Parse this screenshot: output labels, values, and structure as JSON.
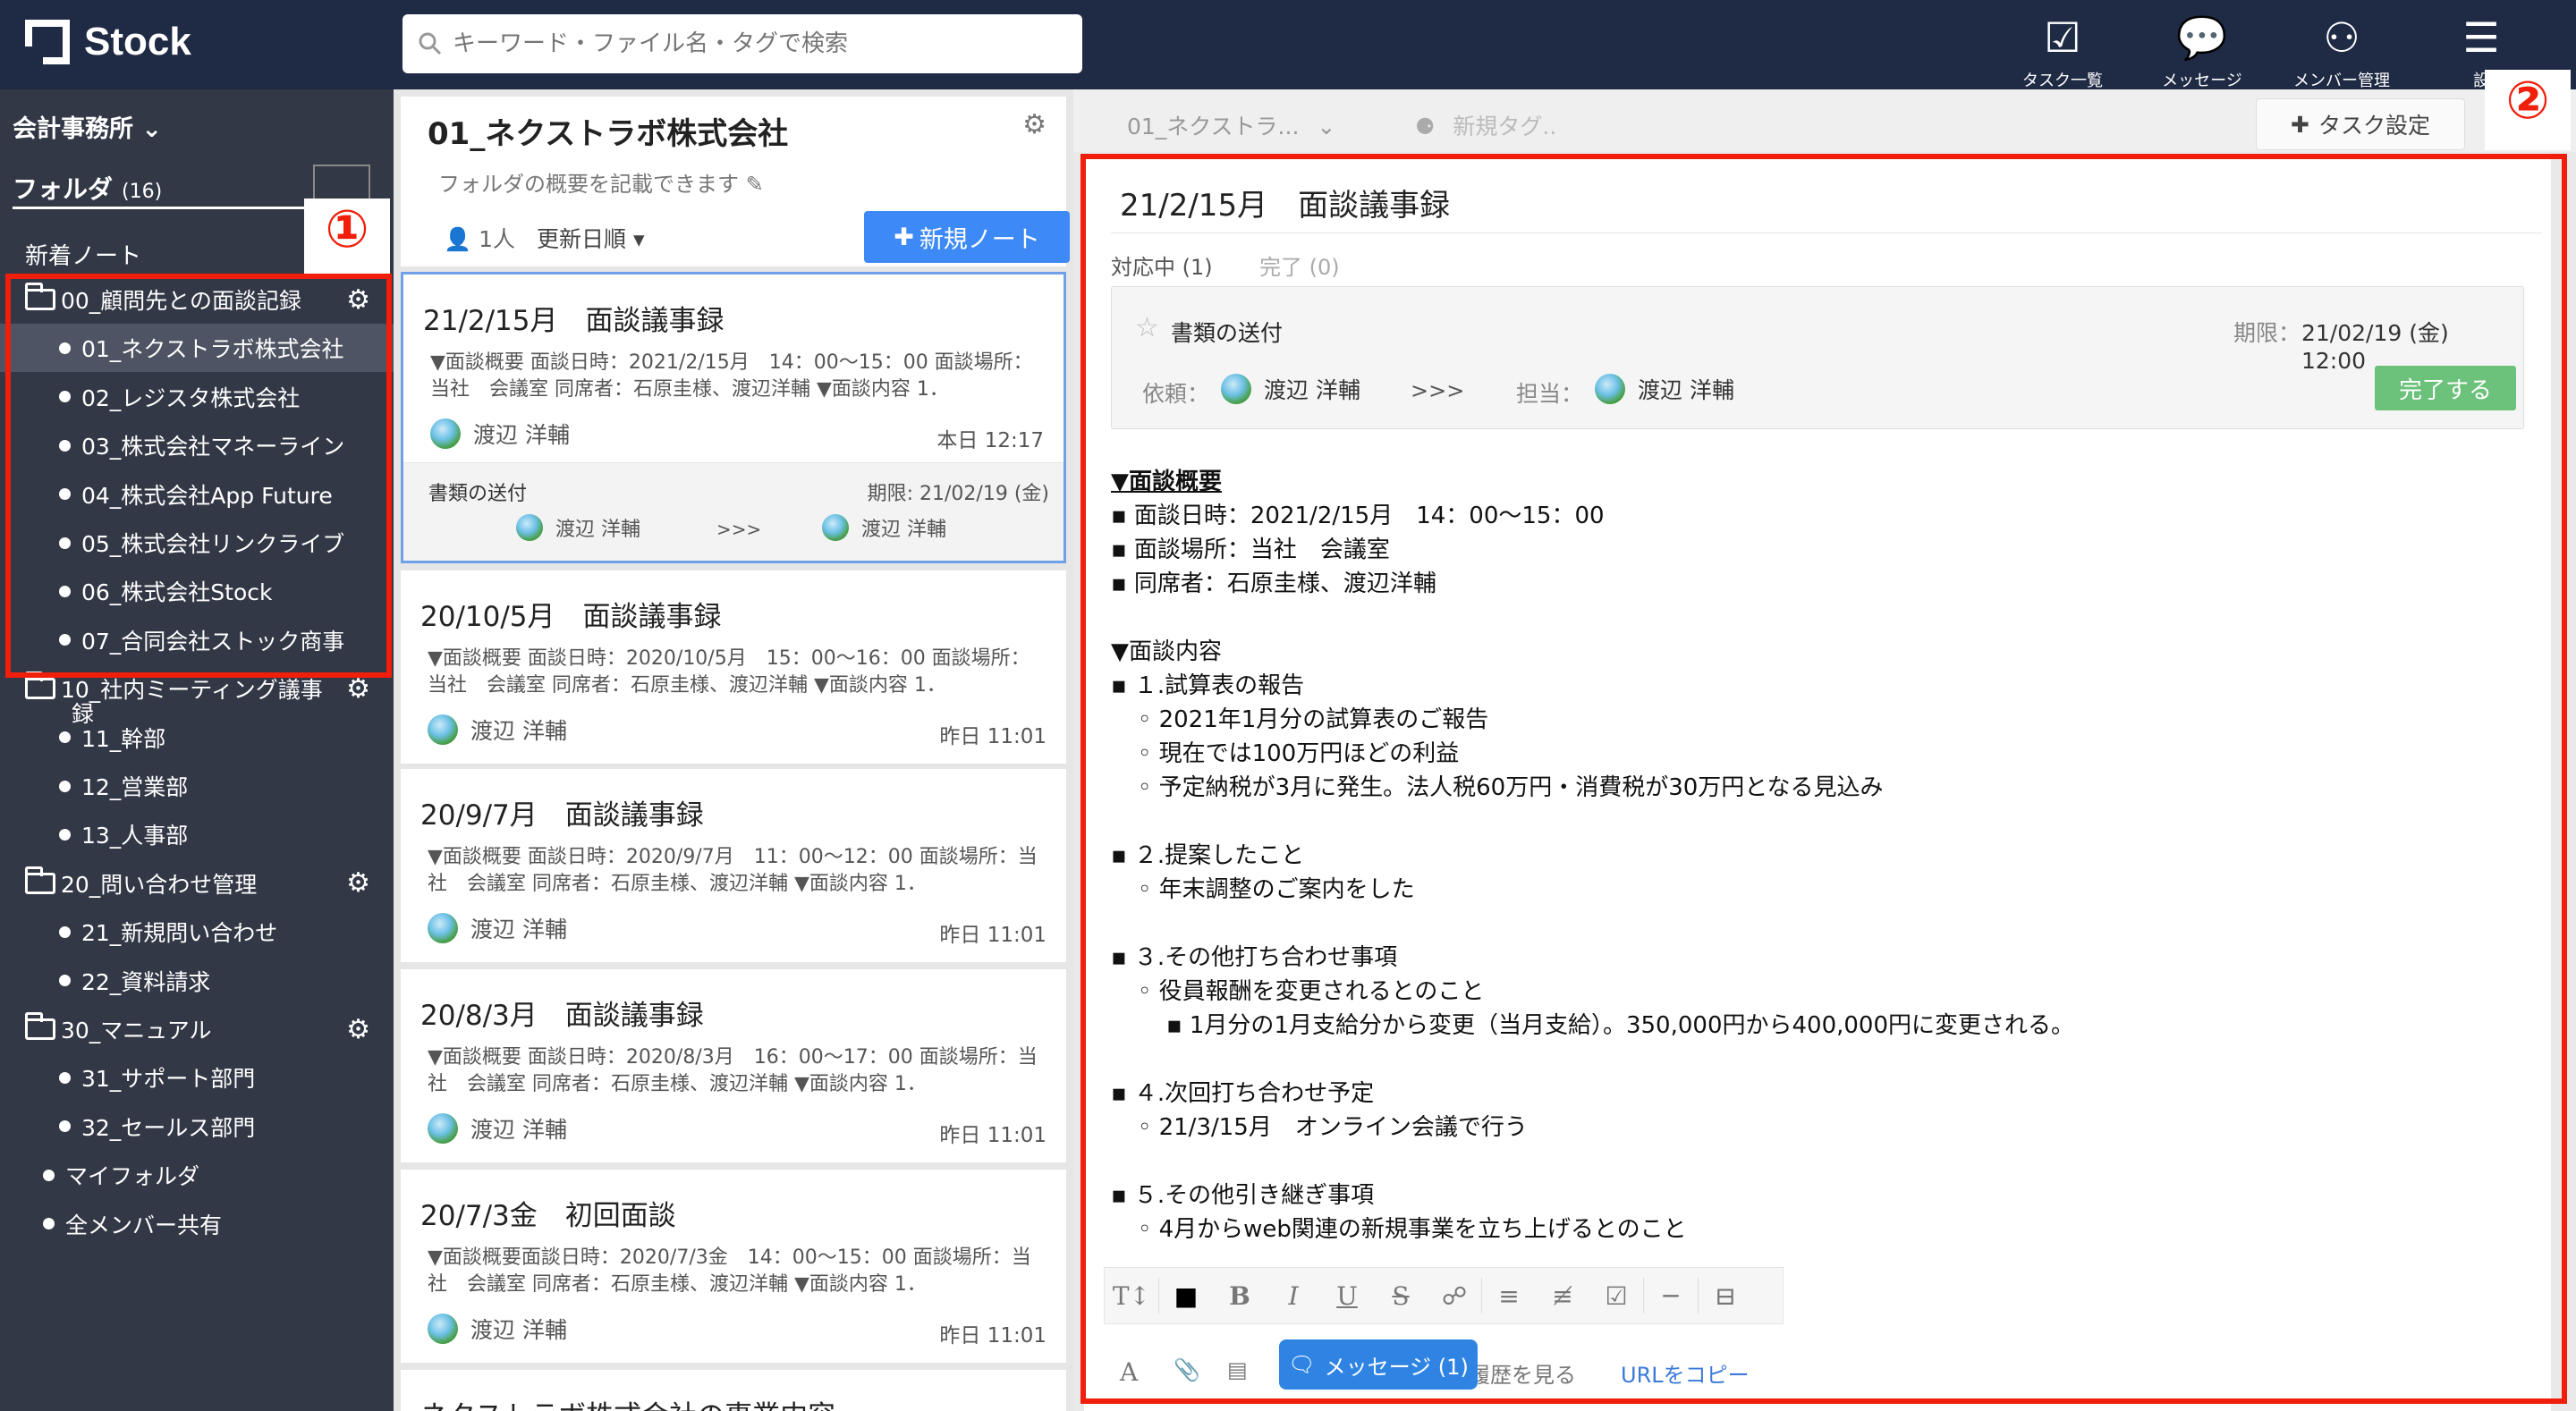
{
  "app": {
    "name": "Stock"
  },
  "search": {
    "placeholder": "キーワード・ファイル名・タグで検索"
  },
  "topnav": [
    {
      "label": "タスク一覧",
      "icon": "task-check-icon"
    },
    {
      "label": "メッセージ",
      "icon": "speech-bubble-icon"
    },
    {
      "label": "メンバー管理",
      "icon": "members-icon"
    },
    {
      "label": "設",
      "icon": "menu-icon"
    }
  ],
  "sidebar": {
    "office": "会計事務所",
    "folder_tab": "フォルダ",
    "folder_count": "(16)",
    "new_notes": "新着ノート",
    "items": [
      {
        "label": "00_顧問先との面談記録",
        "type": "folder",
        "gear": true
      },
      {
        "label": "01_ネクストラボ株式会社",
        "type": "sub",
        "selected": true
      },
      {
        "label": "02_レジスタ株式会社",
        "type": "sub"
      },
      {
        "label": "03_株式会社マネーライン",
        "type": "sub"
      },
      {
        "label": "04_株式会社App Future",
        "type": "sub"
      },
      {
        "label": "05_株式会社リンクライブ",
        "type": "sub"
      },
      {
        "label": "06_株式会社Stock",
        "type": "sub"
      },
      {
        "label": "07_合同会社ストック商事",
        "type": "sub"
      },
      {
        "label": "10_社内ミーティング議事",
        "label2": "録",
        "type": "folder",
        "gear": true
      },
      {
        "label": "11_幹部",
        "type": "sub"
      },
      {
        "label": "12_営業部",
        "type": "sub"
      },
      {
        "label": "13_人事部",
        "type": "sub"
      },
      {
        "label": "20_問い合わせ管理",
        "type": "folder",
        "gear": true
      },
      {
        "label": "21_新規問い合わせ",
        "type": "sub"
      },
      {
        "label": "22_資料請求",
        "type": "sub"
      },
      {
        "label": "30_マニュアル",
        "type": "folder",
        "gear": true
      },
      {
        "label": "31_サポート部門",
        "type": "sub"
      },
      {
        "label": "32_セールス部門",
        "type": "sub"
      },
      {
        "label": "マイフォルダ",
        "type": "top"
      },
      {
        "label": "全メンバー共有",
        "type": "top"
      }
    ]
  },
  "notelist": {
    "title": "01_ネクストラボ株式会社",
    "description": "フォルダの概要を記載できます",
    "members": "1人",
    "sort": "更新日順",
    "new_button": "新規ノート",
    "cards": [
      {
        "title": "21/2/15月　面談議事録",
        "excerpt": "▼面談概要 面談日時：2021/2/15月　14：00〜15：00 面談場所：当社　会議室 同席者：石原圭様、渡辺洋輔 ▼面談内容 1．",
        "author": "渡辺 洋輔",
        "time": "本日 12:17",
        "task": {
          "name": "書類の送付",
          "due": "期限: 21/02/19 (金)",
          "from": "渡辺 洋輔",
          "arrow": ">>>",
          "to": "渡辺 洋輔"
        }
      },
      {
        "title": "20/10/5月　面談議事録",
        "excerpt": "▼面談概要 面談日時：2020/10/5月　15：00〜16：00 面談場所：当社　会議室 同席者：石原圭様、渡辺洋輔 ▼面談内容 1．",
        "author": "渡辺 洋輔",
        "time": "昨日 11:01"
      },
      {
        "title": "20/9/7月　面談議事録",
        "excerpt": "▼面談概要 面談日時：2020/9/7月　11：00〜12：00 面談場所：当社　会議室 同席者：石原圭様、渡辺洋輔 ▼面談内容 1．",
        "author": "渡辺 洋輔",
        "time": "昨日 11:01"
      },
      {
        "title": "20/8/3月　面談議事録",
        "excerpt": "▼面談概要 面談日時：2020/8/3月　16：00〜17：00 面談場所：当社　会議室 同席者：石原圭様、渡辺洋輔 ▼面談内容 1．",
        "author": "渡辺 洋輔",
        "time": "昨日 11:01"
      },
      {
        "title": "20/7/3金　初回面談",
        "excerpt": "▼面談概要面談日時：2020/7/3金　14：00〜15：00 面談場所：当社　会議室 同席者：石原圭様、渡辺洋輔 ▼面談内容 1．",
        "author": "渡辺 洋輔",
        "time": "昨日 11:01"
      },
      {
        "title": "ネクストラボ株式会社の事業内容",
        "excerpt": "",
        "author": "",
        "time": ""
      }
    ]
  },
  "detail": {
    "breadcrumb": "01_ネクストラ...",
    "new_tag": "新規タグ..",
    "task_setting": "タスク設定",
    "title": "21/2/15月　面談議事録",
    "tab_open": "対応中 (1)",
    "tab_done": "完了 (0)",
    "task": {
      "name": "書類の送付",
      "due_label": "期限：",
      "due": "21/02/19 (金)　12:00",
      "req_label": "依頼：",
      "requester": "渡辺 洋輔",
      "arrow": ">>>",
      "assignee_label": "担当：",
      "assignee": "渡辺 洋輔",
      "complete_button": "完了する"
    },
    "body": [
      {
        "text": "▼面談概要",
        "level": 0,
        "style": "ul"
      },
      {
        "text": "▪ 面談日時：2021/2/15月　14：00〜15：00",
        "level": 1
      },
      {
        "text": "▪ 面談場所：当社　会議室",
        "level": 1
      },
      {
        "text": "▪ 同席者：石原圭様、渡辺洋輔",
        "level": 1
      },
      {
        "text": "",
        "level": 0
      },
      {
        "text": "▼面談内容",
        "level": 0
      },
      {
        "text": "▪ １.試算表の報告",
        "level": 1
      },
      {
        "text": "◦ 2021年1月分の試算表のご報告",
        "level": 2
      },
      {
        "text": "◦ 現在では100万円ほどの利益",
        "level": 2
      },
      {
        "text": "◦ 予定納税が3月に発生。法人税60万円・消費税が30万円となる見込み",
        "level": 2
      },
      {
        "text": "",
        "level": 0
      },
      {
        "text": "▪ ２.提案したこと",
        "level": 1
      },
      {
        "text": "◦ 年末調整のご案内をした",
        "level": 2
      },
      {
        "text": "",
        "level": 0
      },
      {
        "text": "▪ ３.その他打ち合わせ事項",
        "level": 1
      },
      {
        "text": "◦ 役員報酬を変更されるとのこと",
        "level": 2
      },
      {
        "text": "▪ 1月分の1月支給分から変更（当月支給）。350,000円から400,000円に変更される。",
        "level": 3
      },
      {
        "text": "",
        "level": 0
      },
      {
        "text": "▪ ４.次回打ち合わせ予定",
        "level": 1
      },
      {
        "text": "◦ 21/3/15月　オンライン会議で行う",
        "level": 2
      },
      {
        "text": "",
        "level": 0
      },
      {
        "text": "▪ ５.その他引き継ぎ事項",
        "level": 1
      },
      {
        "text": "◦ 4月からweb関連の新規事業を立ち上げるとのこと",
        "level": 2
      }
    ],
    "history_link": "編集履歴を見る",
    "copy_url": "URLをコピー",
    "message_button": "メッセージ (1)"
  },
  "annotations": {
    "one": "①",
    "two": "②"
  },
  "colors": {
    "topbar": "#1f2a44",
    "sidebar": "#333846",
    "accent": "#3d8af7",
    "complete": "#6cc17b",
    "annotation": "#f01e0a"
  }
}
